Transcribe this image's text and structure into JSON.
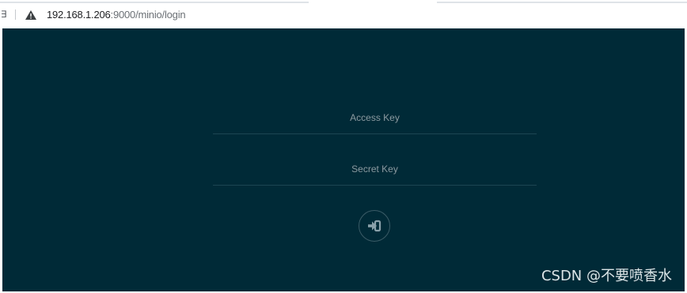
{
  "browser": {
    "edge_glyph": "∃",
    "url_host": "192.168.1.206",
    "url_rest": ":9000/minio/login",
    "security_icon": "warning-triangle-icon"
  },
  "login": {
    "access_key_placeholder": "Access Key",
    "access_key_value": "",
    "secret_key_placeholder": "Secret Key",
    "secret_key_value": "",
    "submit_icon": "sign-in-icon"
  },
  "watermark": "CSDN @不要喷香水",
  "colors": {
    "page_background": "#002a37",
    "field_underline": "#1d4552",
    "button_border": "#3b5c67",
    "icon_color": "#8aa1aa"
  }
}
